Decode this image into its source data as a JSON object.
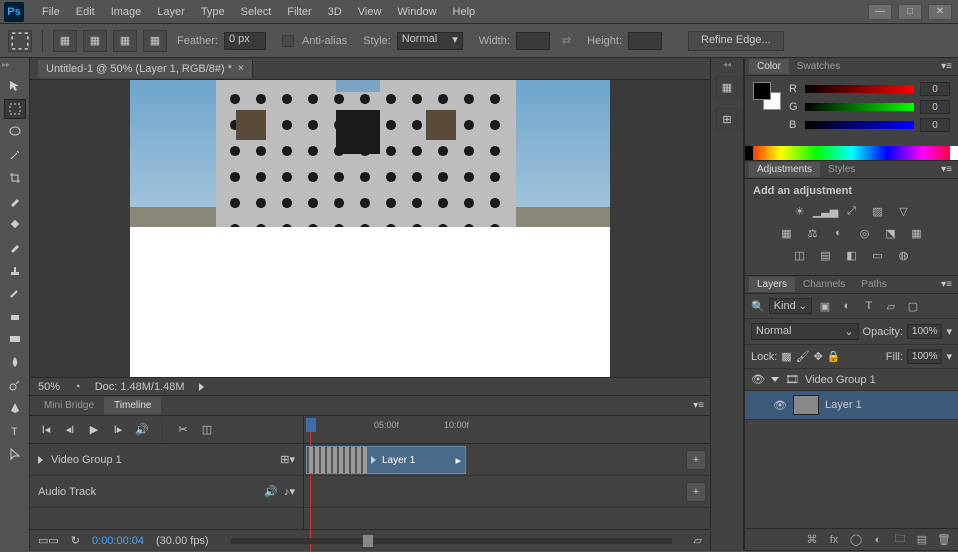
{
  "menu": [
    "File",
    "Edit",
    "Image",
    "Layer",
    "Type",
    "Select",
    "Filter",
    "3D",
    "View",
    "Window",
    "Help"
  ],
  "options": {
    "feather_label": "Feather:",
    "feather_value": "0 px",
    "antialias_label": "Anti-alias",
    "style_label": "Style:",
    "style_value": "Normal",
    "width_label": "Width:",
    "height_label": "Height:",
    "refine_label": "Refine Edge..."
  },
  "document": {
    "tab_title": "Untitled-1 @ 50% (Layer 1, RGB/8#) *",
    "zoom": "50%",
    "doc_info": "Doc: 1.48M/1.48M"
  },
  "timeline": {
    "tab_mini": "Mini Bridge",
    "tab_timeline": "Timeline",
    "ticks": [
      "05:00f",
      "10:00f"
    ],
    "group_name": "Video Group 1",
    "audio_name": "Audio Track",
    "clip_name": "Layer 1",
    "timecode": "0:00:00:04",
    "fps": "(30.00 fps)"
  },
  "color": {
    "tab_color": "Color",
    "tab_swatches": "Swatches",
    "r_label": "R",
    "r_value": "0",
    "g_label": "G",
    "g_value": "0",
    "b_label": "B",
    "b_value": "0"
  },
  "adjustments": {
    "tab_adj": "Adjustments",
    "tab_styles": "Styles",
    "heading": "Add an adjustment"
  },
  "layers": {
    "tab_layers": "Layers",
    "tab_channels": "Channels",
    "tab_paths": "Paths",
    "kind": "Kind",
    "blend": "Normal",
    "opacity_label": "Opacity:",
    "opacity_value": "100%",
    "lock_label": "Lock:",
    "fill_label": "Fill:",
    "fill_value": "100%",
    "group_name": "Video Group 1",
    "layer_name": "Layer 1"
  }
}
